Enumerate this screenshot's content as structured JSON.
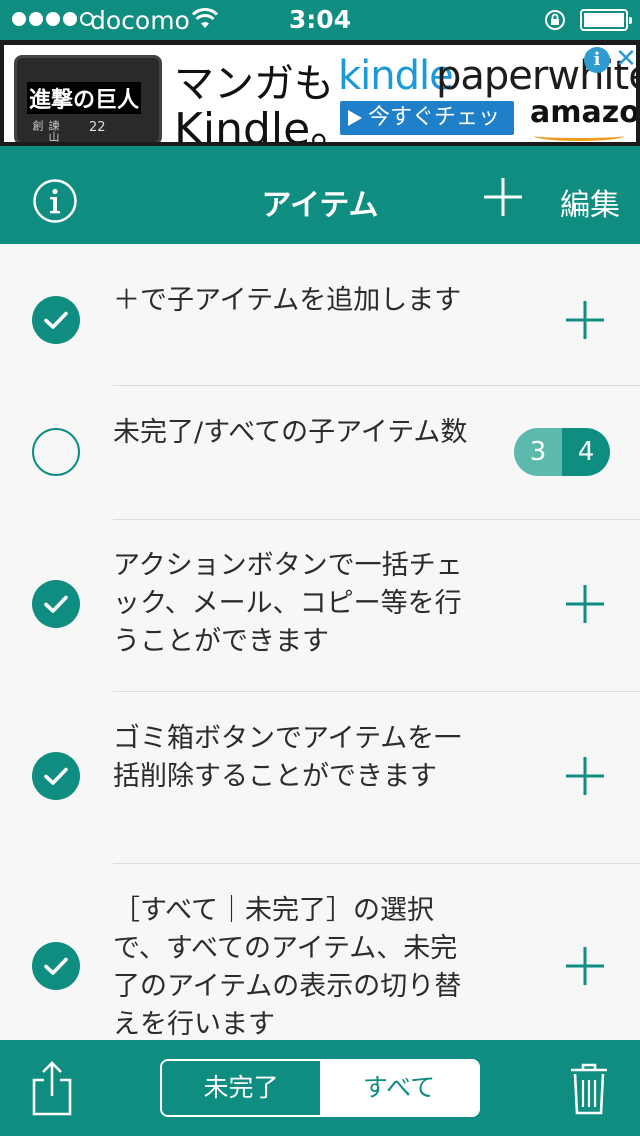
{
  "status_bar": {
    "carrier": "docomo",
    "time": "3:04"
  },
  "ad": {
    "cover_title": "進撃の巨人",
    "cover_volume": "22",
    "cover_author": "諫山創",
    "headline_line1": "マンガも",
    "headline_line2": "Kindle。",
    "brand_kindle": "kindle",
    "brand_paperwhite": "paperwhite",
    "cta_label": "今すぐチェック",
    "amazon_label": "amazon",
    "info_glyph": "i",
    "close_glyph": "✕"
  },
  "navbar": {
    "title": "アイテム",
    "edit_label": "編集",
    "info_icon": "info-circle-icon",
    "add_icon": "plus-icon"
  },
  "items": [
    {
      "text": "＋で子アイテムを追加します",
      "checked": true,
      "trailing": "plus"
    },
    {
      "text": "未完了/すべての子アイテム数",
      "checked": false,
      "trailing": "count",
      "count_incomplete": "3",
      "count_all": "4"
    },
    {
      "text": "アクションボタンで一括チェック、メール、コピー等を行うことができます",
      "checked": true,
      "trailing": "plus"
    },
    {
      "text": "ゴミ箱ボタンでアイテムを一括削除することができます",
      "checked": true,
      "trailing": "plus"
    },
    {
      "text": "［すべて｜未完了］の選択で、すべてのアイテム、未完了のアイテムの表示の切り替えを行います",
      "checked": true,
      "trailing": "plus"
    }
  ],
  "toolbar": {
    "segment_incomplete": "未完了",
    "segment_all": "すべて",
    "selected_segment": "すべて",
    "share_icon": "share-icon",
    "trash_icon": "trash-icon"
  },
  "colors": {
    "accent": "#0f8d80",
    "accent_light": "#5db8ae",
    "background": "#f7f7f7"
  }
}
